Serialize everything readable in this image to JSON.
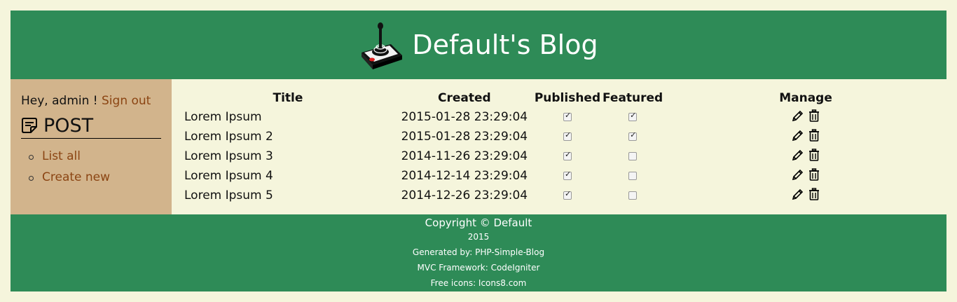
{
  "header": {
    "title": "Default's Blog",
    "logo_icon": "joystick-icon"
  },
  "sidebar": {
    "greeting": "Hey, admin !",
    "signout_label": "Sign out",
    "section_title": "POST",
    "section_icon": "note-icon",
    "links": [
      "List all",
      "Create new"
    ]
  },
  "table": {
    "headers": {
      "title": "Title",
      "created": "Created",
      "published": "Published",
      "featured": "Featured",
      "manage": "Manage"
    },
    "rows": [
      {
        "title": "Lorem Ipsum",
        "created": "2015-01-28 23:29:04",
        "published": true,
        "featured": true
      },
      {
        "title": "Lorem Ipsum 2",
        "created": "2015-01-28 23:29:04",
        "published": true,
        "featured": true
      },
      {
        "title": "Lorem Ipsum 3",
        "created": "2014-11-26 23:29:04",
        "published": true,
        "featured": false
      },
      {
        "title": "Lorem Ipsum 4",
        "created": "2014-12-14 23:29:04",
        "published": true,
        "featured": false
      },
      {
        "title": "Lorem Ipsum 5",
        "created": "2014-12-26 23:29:04",
        "published": true,
        "featured": false
      }
    ],
    "edit_icon": "pencil-icon",
    "delete_icon": "trash-icon"
  },
  "footer": {
    "copyright": "Copyright © Default",
    "year": "2015",
    "generated": "Generated by: PHP-Simple-Blog",
    "framework": "MVC Framework: CodeIgniter",
    "icons": "Free icons: Icons8.com"
  },
  "colors": {
    "header_bg": "#2e8b57",
    "sidebar_bg": "#d2b48c",
    "page_bg": "#f5f5dc",
    "link": "#8b4513"
  }
}
